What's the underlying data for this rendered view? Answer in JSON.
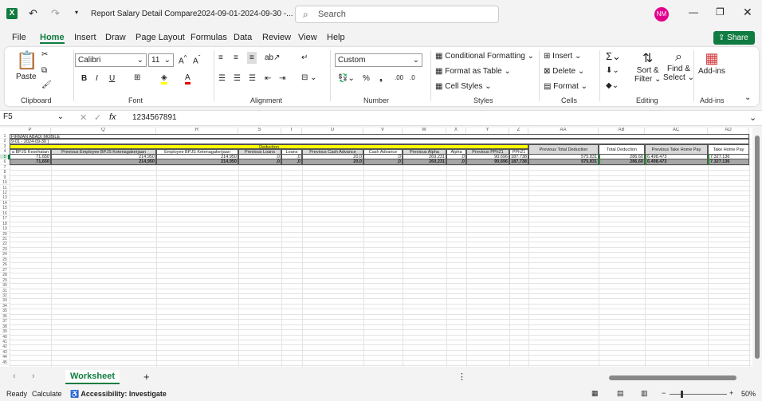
{
  "titlebar": {
    "title": "Report Salary Detail Compare2024-09-01-2024-09-30  -...",
    "search_placeholder": "Search",
    "avatar": "NM"
  },
  "menu": [
    "File",
    "Home",
    "Insert",
    "Draw",
    "Page Layout",
    "Formulas",
    "Data",
    "Review",
    "View",
    "Help"
  ],
  "share": "Share",
  "ribbon": {
    "paste": "Paste",
    "clipboard": "Clipboard",
    "font_name": "Calibri",
    "font_size": "11",
    "font": "Font",
    "alignment": "Alignment",
    "number_format": "Custom",
    "number": "Number",
    "conditional": "Conditional Formatting",
    "format_table": "Format as Table",
    "cell_styles": "Cell Styles",
    "styles": "Styles",
    "insert": "Insert",
    "delete": "Delete",
    "format": "Format",
    "cells": "Cells",
    "sort": "Sort &",
    "filter": "Filter",
    "find": "Find &",
    "select": "Select",
    "editing": "Editing",
    "addins": "Add-ins",
    "addins_group": "Add-ins"
  },
  "formula": {
    "name_box": "F5",
    "fx": "fx",
    "value": "1234567891"
  },
  "sheet": {
    "columns": [
      "P",
      "Q",
      "R",
      "S",
      "T",
      "U",
      "V",
      "W",
      "X",
      "Y",
      "Z",
      "AA",
      "AB",
      "AC",
      "AD"
    ],
    "company": "FIRMAN ABADI MOBILE",
    "period": "9-01 - 2024-09-30 )",
    "deduction": "Deduction",
    "headers": [
      "a BPJS Kesehatan",
      "Previous Employee BPJS Ketenagakerjaan",
      "Employee BPJS Ketenagakerjaan",
      "Previous Loans",
      "Loans",
      "Previous Cash Advance",
      "Cash Advance",
      "Previous Alpha",
      "Alpha",
      "Previous PPh21",
      "PPh21",
      "Previous Total Deduction",
      "Total Deduction",
      "Previous Take Home Pay",
      "Take Home Pay"
    ],
    "row5": [
      "71.650",
      "214.950",
      "214.950",
      ",0",
      ",0",
      "20,0",
      ",0",
      "269.231",
      ",0",
      "90.696",
      "187.738",
      "575.831",
      "286.60",
      "6.498.473",
      "7.327.136"
    ],
    "row6": [
      "71,650",
      "214,950",
      "214,950",
      ",0",
      ",0",
      "20,0",
      ",0",
      "269,231",
      ",0",
      "90,696",
      "187,738",
      "575,831",
      "286,60",
      "6.498.473",
      "7.327.136"
    ]
  },
  "tabs": {
    "active": "Worksheet"
  },
  "status": {
    "ready": "Ready",
    "calculate": "Calculate",
    "accessibility": "Accessibility: Investigate",
    "zoom": "50%"
  },
  "colors": {
    "excel_green": "#107c41",
    "yellow": "#ffff00",
    "gray_header": "#d9d9d9",
    "total_row": "#a6a6a6"
  }
}
